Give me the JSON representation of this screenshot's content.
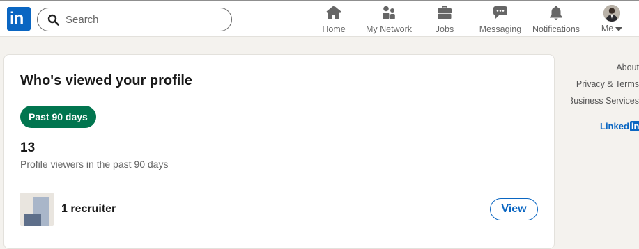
{
  "header": {
    "logo_text": "in",
    "search": {
      "placeholder": "Search",
      "value": ""
    },
    "nav": [
      {
        "label": "Home",
        "icon": "home-icon"
      },
      {
        "label": "My Network",
        "icon": "people-icon"
      },
      {
        "label": "Jobs",
        "icon": "briefcase-icon"
      },
      {
        "label": "Messaging",
        "icon": "chat-icon"
      },
      {
        "label": "Notifications",
        "icon": "bell-icon"
      },
      {
        "label": "Me",
        "icon": "avatar"
      }
    ]
  },
  "main": {
    "title": "Who's viewed your profile",
    "filter_label": "Past 90 days",
    "viewer_count": "13",
    "viewer_caption": "Profile viewers in the past 90 days",
    "row": {
      "label": "1 recruiter",
      "action_label": "View"
    }
  },
  "sidebar_footer": {
    "links": [
      "About",
      "Privacy & Terms",
      "Business Services"
    ],
    "brand_text": "Linked",
    "brand_box": "in"
  },
  "colors": {
    "brand_blue": "#0a66c2",
    "pill_green": "#01754f",
    "page_bg": "#f4f2ee"
  }
}
